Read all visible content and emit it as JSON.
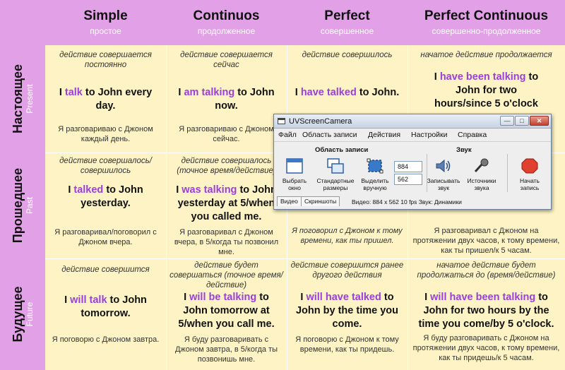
{
  "header": {
    "columns": [
      {
        "en": "Simple",
        "ru": "простое"
      },
      {
        "en": "Continuos",
        "ru": "продолженное"
      },
      {
        "en": "Perfect",
        "ru": "совершенное"
      },
      {
        "en": "Perfect Continuous",
        "ru": "совершенно-продолженное"
      }
    ]
  },
  "rows": [
    {
      "ru": "Настоящее",
      "en": "Present"
    },
    {
      "ru": "Прошедшее",
      "en": "Past"
    },
    {
      "ru": "Будущее",
      "en": "Future"
    }
  ],
  "cells": {
    "present_simple": {
      "desc": "действие совершается постоянно",
      "pre": "I ",
      "verb": "talk",
      "post": " to John every day.",
      "trans": "Я разговариваю с Джоном каждый день."
    },
    "present_continuous": {
      "desc": "действие совершается сейчас",
      "pre": "I ",
      "verb": "am talking",
      "post": " to John now.",
      "trans": "Я разговариваю с Джоном сейчас."
    },
    "present_perfect": {
      "desc": "действие совершилось",
      "pre": "I ",
      "verb": "have talked",
      "post": " to John.",
      "trans": ""
    },
    "present_perfect_continuous": {
      "desc": "начатое действие продолжается",
      "pre": "I ",
      "verb": "have been talking",
      "post": " to John for two hours/since 5 o'clock",
      "trans": ""
    },
    "past_simple": {
      "desc": "действие совершалось/совершилось",
      "pre": "I ",
      "verb": "talked",
      "post": " to John yesterday.",
      "trans": "Я разговаривал/поговорил с Джоном вчера."
    },
    "past_continuous": {
      "desc": "действие совершалось (точное время/действие)",
      "pre": "I ",
      "verb": "was talking",
      "post": " to John yesterday at 5/when you called me.",
      "trans": "Я разговаривал с Джоном вчера, в 5/когда ты позвонил мне."
    },
    "past_perfect": {
      "desc": "",
      "pre": "",
      "verb": "",
      "post": "",
      "trans": "Я поговорил с Джоном к тому времени, как ты пришел."
    },
    "past_perfect_continuous": {
      "desc": "",
      "pre": "",
      "verb": "",
      "post": "",
      "trans": "Я разговаривал с Джоном на протяжении двух часов, к тому времени, как ты пришел/к 5 часам."
    },
    "future_simple": {
      "desc": "действие совершится",
      "pre": "I ",
      "verb": "will talk",
      "post": " to John tomorrow.",
      "trans": "Я поговорю с Джоном завтра."
    },
    "future_continuous": {
      "desc": "действие будет совершаться (точное время/действие)",
      "pre": "I ",
      "verb": "will be talking",
      "post": " to John tomorrow at 5/when you call me.",
      "trans": "Я буду разговаривать с Джоном завтра, в 5/когда ты позвонишь мне."
    },
    "future_perfect": {
      "desc": "действие совершится ранее другого действия",
      "pre": "I ",
      "verb": "will have talked",
      "post": " to John by the time you come.",
      "trans": "Я поговорю с Джоном к тому времени, как ты придешь."
    },
    "future_perfect_continuous": {
      "desc": "начатое действие будет продолжаться до (время/действие)",
      "pre": "I ",
      "verb": "will have been talking",
      "post": " to John for two hours by the time you come/by 5 o'clock.",
      "trans": "Я буду разговаривать с Джоном на протяжении двух часов, к тому времени, как ты придешь/к 5 часам."
    }
  },
  "window": {
    "title": "UVScreenCamera",
    "controls": {
      "min": "—",
      "max": "□",
      "close": "✕"
    },
    "menu": [
      "Файл",
      "Область записи",
      "Действия",
      "Настройки",
      "Справка"
    ],
    "group_area": "Область записи",
    "group_sound": "Звук",
    "tools": {
      "choose_window": "Выбрать окно",
      "standard_sizes": "Стандартные размеры",
      "select_manually": "Выделить вручную",
      "record_sound": "Записывать звук",
      "sound_sources": "Источники звука",
      "start_recording": "Начать запись"
    },
    "width_value": "884",
    "height_value": "562",
    "tabs": [
      "Видео",
      "Скриншоты"
    ],
    "status": "Видео: 884 x 562  10 fps  Звук: Динамики"
  },
  "colors": {
    "header_bg": "#e2a0e6",
    "cell_bg": "#fdf3c4",
    "verb_highlight": "#9b3fd9",
    "record_button": "#e04030"
  }
}
